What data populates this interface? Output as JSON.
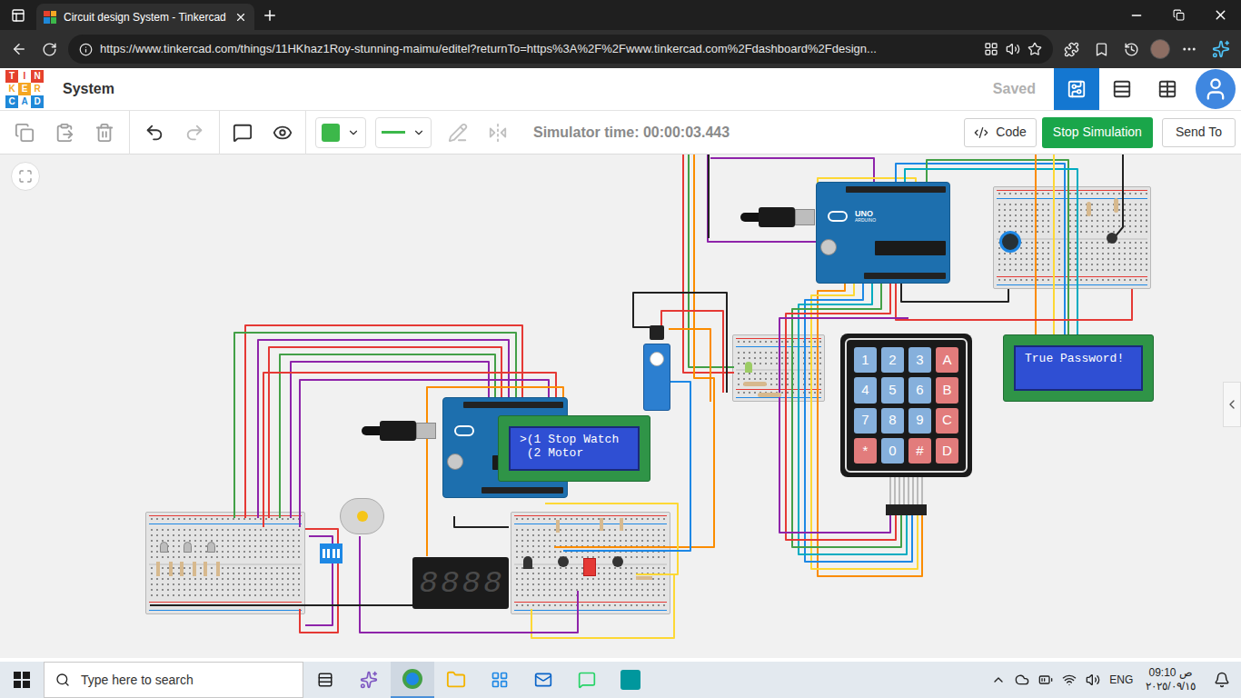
{
  "browser": {
    "tab": {
      "title": "Circuit design System - Tinkercad",
      "selected": true
    },
    "url": "https://www.tinkercad.com/things/11HKhaz1Roy-stunning-maimu/editel?returnTo=https%3A%2F%2Fwww.tinkercad.com%2Fdashboard%2Fdesign..."
  },
  "app": {
    "logo": [
      "T",
      "I",
      "N",
      "K",
      "E",
      "R",
      "C",
      "A",
      "D"
    ],
    "title": "System",
    "save_status": "Saved",
    "views": [
      {
        "name": "circuit",
        "selected": true
      },
      {
        "name": "schematic",
        "selected": false
      },
      {
        "name": "components",
        "selected": false
      }
    ]
  },
  "toolbar": {
    "wire_color": "#3cb84a",
    "simulator_time": "Simulator time: 00:00:03.443",
    "code_button": "Code",
    "stop_button": "Stop Simulation",
    "send_button": "Send To"
  },
  "canvas": {
    "arduino": {
      "label": "UNO",
      "brand": "ARDUINO"
    },
    "lcds": [
      {
        "lines": [
          ">(1 Stop Watch",
          " (2 Motor"
        ]
      },
      {
        "lines": [
          "True Password!"
        ]
      }
    ],
    "keypad": {
      "keys": [
        {
          "label": "1",
          "kind": "digit"
        },
        {
          "label": "2",
          "kind": "digit"
        },
        {
          "label": "3",
          "kind": "digit"
        },
        {
          "label": "A",
          "kind": "letter"
        },
        {
          "label": "4",
          "kind": "digit"
        },
        {
          "label": "5",
          "kind": "digit"
        },
        {
          "label": "6",
          "kind": "digit"
        },
        {
          "label": "B",
          "kind": "letter"
        },
        {
          "label": "7",
          "kind": "digit"
        },
        {
          "label": "8",
          "kind": "digit"
        },
        {
          "label": "9",
          "kind": "digit"
        },
        {
          "label": "C",
          "kind": "letter"
        },
        {
          "label": "*",
          "kind": "symbol"
        },
        {
          "label": "0",
          "kind": "digit"
        },
        {
          "label": "#",
          "kind": "symbol"
        },
        {
          "label": "D",
          "kind": "letter"
        }
      ]
    },
    "seven_segment": {
      "digits": [
        "8",
        "8",
        "8",
        "8"
      ]
    }
  },
  "taskbar": {
    "search_placeholder": "Type here to search",
    "language": "ENG",
    "time": "09:10 ص",
    "date": "٢٠٢٥/٠٩/١٥"
  }
}
